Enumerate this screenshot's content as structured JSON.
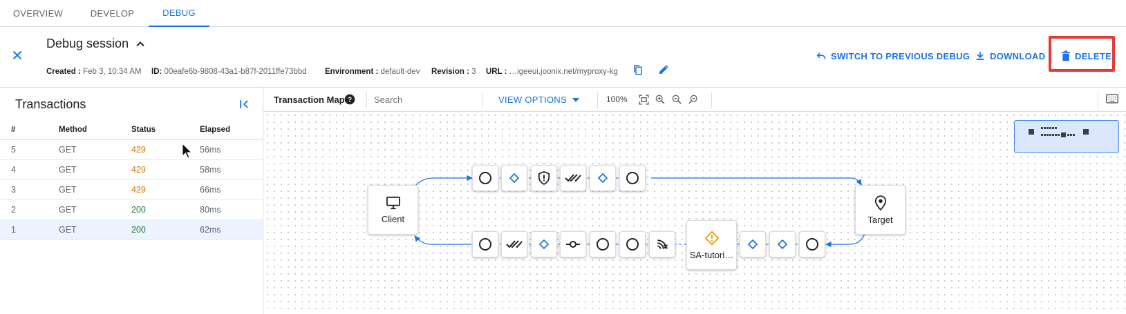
{
  "tabs": [
    {
      "label": "OVERVIEW"
    },
    {
      "label": "DEVELOP"
    },
    {
      "label": "DEBUG"
    }
  ],
  "active_tab": "DEBUG",
  "header": {
    "title": "Debug session",
    "meta": {
      "created_label": "Created :",
      "created_value": "Feb 3, 10:34 AM",
      "id_label": "ID:",
      "id_value": "00eafe6b-9808-43a1-b87f-2011ffe73bbd",
      "env_label": "Environment :",
      "env_value": "default-dev",
      "rev_label": "Revision :",
      "rev_value": "3",
      "url_label": "URL :",
      "url_value": "…igeeui.joonix.net/myproxy-kg"
    },
    "actions": {
      "switch": "SWITCH TO PREVIOUS DEBUG",
      "download": "DOWNLOAD",
      "delete": "DELETE"
    }
  },
  "transactions": {
    "title": "Transactions",
    "columns": [
      "#",
      "Method",
      "Status",
      "Elapsed"
    ],
    "rows": [
      {
        "num": "5",
        "method": "GET",
        "status": "429",
        "elapsed": "56ms"
      },
      {
        "num": "4",
        "method": "GET",
        "status": "429",
        "elapsed": "58ms"
      },
      {
        "num": "3",
        "method": "GET",
        "status": "429",
        "elapsed": "66ms"
      },
      {
        "num": "2",
        "method": "GET",
        "status": "200",
        "elapsed": "80ms"
      },
      {
        "num": "1",
        "method": "GET",
        "status": "200",
        "elapsed": "62ms"
      }
    ],
    "selected_row": "1"
  },
  "toolbar": {
    "map_label": "Transaction Map",
    "search_placeholder": "Search",
    "view_options": "VIEW OPTIONS",
    "zoom": "100%"
  },
  "map": {
    "client_label": "Client",
    "target_label": "Target",
    "sa_label": "SA-tutori…",
    "request_steps": [
      "circle-icon",
      "diamond-icon",
      "shield-icon",
      "double-check-icon",
      "diamond-icon",
      "circle-icon"
    ],
    "response_steps": [
      "circle-icon",
      "double-check-icon",
      "diamond-icon",
      "commit-icon",
      "circle-icon",
      "circle-icon",
      "signal-icon",
      "warning-icon",
      "diamond-icon",
      "diamond-icon",
      "circle-icon"
    ]
  },
  "colors": {
    "accent": "#1a73e8",
    "status_429": "#e37400",
    "status_200": "#188038",
    "delete_highlight": "#e53935",
    "warning": "#f29900"
  }
}
